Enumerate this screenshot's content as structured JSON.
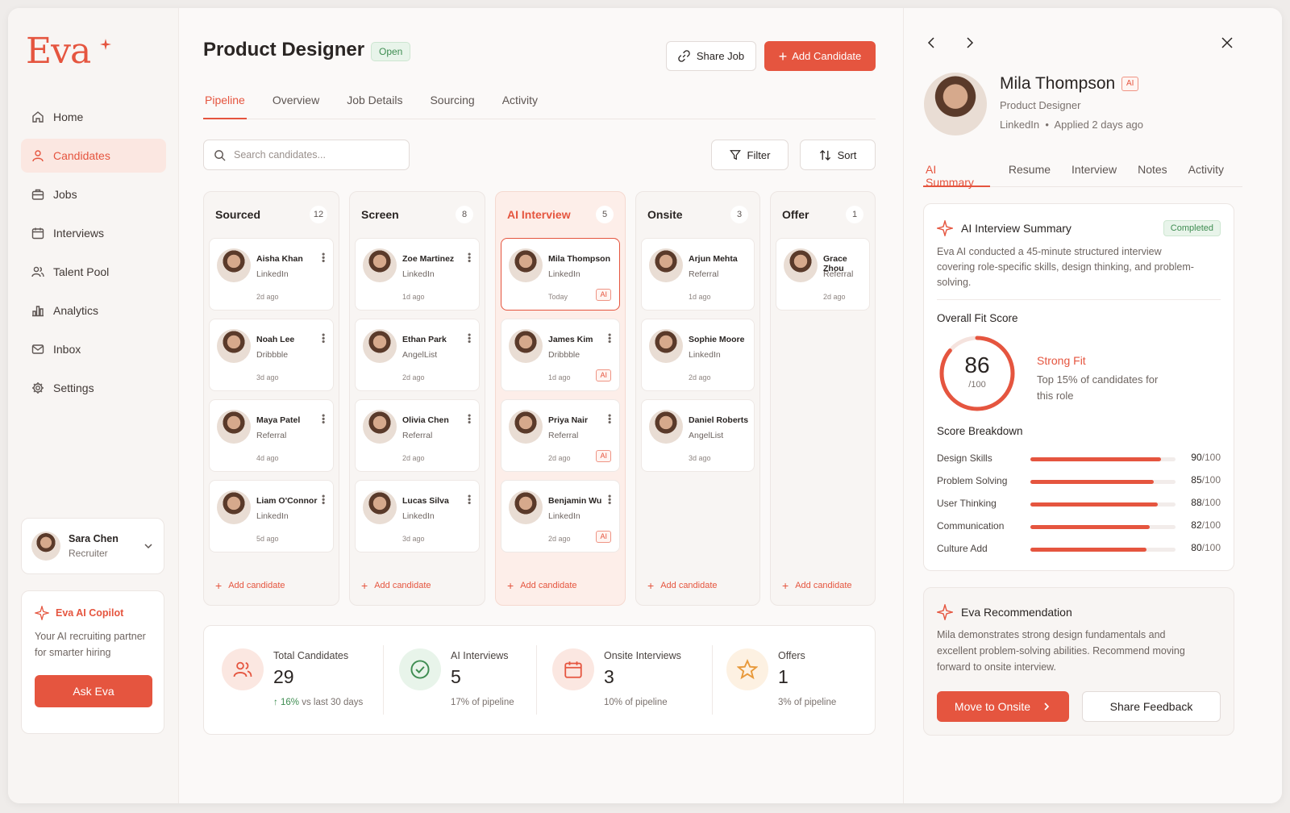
{
  "brand": {
    "name": "Eva",
    "accent": "#e5553f"
  },
  "sidebar": {
    "items": [
      {
        "label": "Home",
        "icon": "home-icon"
      },
      {
        "label": "Candidates",
        "icon": "user-icon",
        "active": true
      },
      {
        "label": "Jobs",
        "icon": "briefcase-icon"
      },
      {
        "label": "Interviews",
        "icon": "calendar-icon"
      },
      {
        "label": "Talent Pool",
        "icon": "users-icon"
      },
      {
        "label": "Analytics",
        "icon": "bar-chart-icon"
      },
      {
        "label": "Inbox",
        "icon": "mail-icon"
      },
      {
        "label": "Settings",
        "icon": "gear-icon"
      }
    ],
    "user": {
      "name": "Sara Chen",
      "role": "Recruiter"
    },
    "copilot": {
      "title": "Eva AI Copilot",
      "description": "Your AI recruiting partner for smarter hiring",
      "button": "Ask Eva"
    }
  },
  "header": {
    "title": "Product Designer",
    "status": "Open",
    "share_label": "Share Job",
    "add_label": "Add Candidate"
  },
  "tabs": [
    "Pipeline",
    "Overview",
    "Job Details",
    "Sourcing",
    "Activity"
  ],
  "toolbar": {
    "search_placeholder": "Search candidates...",
    "filter_label": "Filter",
    "sort_label": "Sort"
  },
  "pipeline": {
    "add_label": "Add candidate",
    "columns": [
      {
        "title": "Sourced",
        "count": "12",
        "cards": [
          {
            "name": "Aisha Khan",
            "source": "LinkedIn",
            "time": "2d ago"
          },
          {
            "name": "Noah Lee",
            "source": "Dribbble",
            "time": "3d ago"
          },
          {
            "name": "Maya Patel",
            "source": "Referral",
            "time": "4d ago"
          },
          {
            "name": "Liam O'Connor",
            "source": "LinkedIn",
            "time": "5d ago"
          }
        ]
      },
      {
        "title": "Screen",
        "count": "8",
        "cards": [
          {
            "name": "Zoe Martinez",
            "source": "LinkedIn",
            "time": "1d ago"
          },
          {
            "name": "Ethan Park",
            "source": "AngelList",
            "time": "2d ago"
          },
          {
            "name": "Olivia Chen",
            "source": "Referral",
            "time": "2d ago"
          },
          {
            "name": "Lucas Silva",
            "source": "LinkedIn",
            "time": "3d ago"
          }
        ]
      },
      {
        "title": "AI Interview",
        "count": "5",
        "cards": [
          {
            "name": "Mila Thompson",
            "source": "LinkedIn",
            "time": "Today",
            "tag": "AI"
          },
          {
            "name": "James Kim",
            "source": "Dribbble",
            "time": "1d ago",
            "tag": "AI"
          },
          {
            "name": "Priya Nair",
            "source": "Referral",
            "time": "2d ago",
            "tag": "AI"
          },
          {
            "name": "Benjamin Wu",
            "source": "LinkedIn",
            "time": "2d ago",
            "tag": "AI"
          }
        ]
      },
      {
        "title": "Onsite",
        "count": "3",
        "cards": [
          {
            "name": "Arjun Mehta",
            "source": "Referral",
            "time": "1d ago"
          },
          {
            "name": "Sophie Moore",
            "source": "LinkedIn",
            "time": "2d ago"
          },
          {
            "name": "Daniel Roberts",
            "source": "AngelList",
            "time": "3d ago"
          }
        ]
      },
      {
        "title": "Offer",
        "count": "1",
        "cards": [
          {
            "name": "Grace Zhou",
            "source": "Referral",
            "time": "2d ago"
          }
        ]
      }
    ]
  },
  "stats": [
    {
      "label": "Total Candidates",
      "value": "29",
      "sub_up": "16%",
      "sub": "vs last 30 days",
      "icon": "users-icon"
    },
    {
      "label": "AI Interviews",
      "value": "5",
      "sub": "17% of pipeline",
      "icon": "check-circle-icon"
    },
    {
      "label": "Onsite Interviews",
      "value": "3",
      "sub": "10% of pipeline",
      "icon": "calendar-icon"
    },
    {
      "label": "Offers",
      "value": "1",
      "sub": "3% of pipeline",
      "icon": "star-icon"
    }
  ],
  "panel": {
    "name": "Mila Thompson",
    "ai_badge": "AI",
    "role": "Product Designer",
    "meta_source": "LinkedIn",
    "meta_applied": "Applied 2 days ago",
    "tabs": [
      "AI Summary",
      "Resume",
      "Interview",
      "Notes",
      "Activity"
    ],
    "summary": {
      "title": "AI Interview Summary",
      "status": "Completed",
      "description": "Eva AI conducted a 45-minute structured interview covering role-specific skills, design thinking, and problem-solving.",
      "fit_title": "Overall Fit Score",
      "score": "86",
      "score_max": "/100",
      "score_fraction": 0.86,
      "fit_label": "Strong Fit",
      "fit_desc": "Top 15% of candidates for this role",
      "breakdown_title": "Score Breakdown",
      "breakdown": [
        {
          "label": "Design Skills",
          "value": "90",
          "max": "/100",
          "fraction": 0.9
        },
        {
          "label": "Problem Solving",
          "value": "85",
          "max": "/100",
          "fraction": 0.85
        },
        {
          "label": "User Thinking",
          "value": "88",
          "max": "/100",
          "fraction": 0.88
        },
        {
          "label": "Communication",
          "value": "82",
          "max": "/100",
          "fraction": 0.82
        },
        {
          "label": "Culture Add",
          "value": "80",
          "max": "/100",
          "fraction": 0.8
        }
      ]
    },
    "recommendation": {
      "title": "Eva Recommendation",
      "text": "Mila demonstrates strong design fundamentals and excellent problem-solving abilities. Recommend moving forward to onsite interview.",
      "primary": "Move to Onsite",
      "secondary": "Share Feedback"
    }
  }
}
